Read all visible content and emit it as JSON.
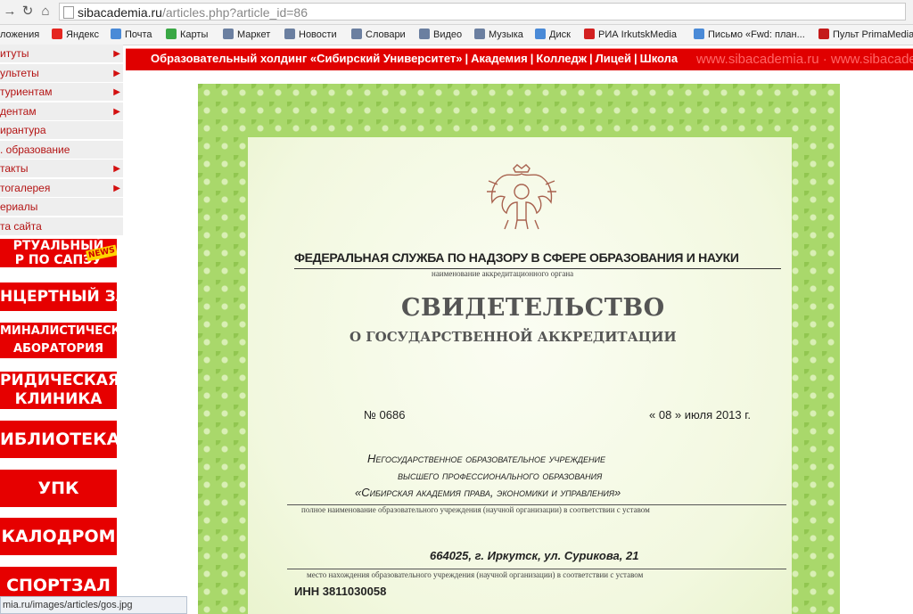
{
  "browser": {
    "url_host": "sibacademia.ru",
    "url_path": "/articles.php?article_id=86"
  },
  "bookmarks": [
    {
      "label": "ложения",
      "color": "#3b79d6"
    },
    {
      "label": "Яндекс",
      "color": "#e52620"
    },
    {
      "label": "Почта",
      "color": "#4a8ad7"
    },
    {
      "label": "Карты",
      "color": "#3aa845"
    },
    {
      "label": "Маркет",
      "color": "#6b7fa0"
    },
    {
      "label": "Новости",
      "color": "#6b7fa0"
    },
    {
      "label": "Словари",
      "color": "#6b7fa0"
    },
    {
      "label": "Видео",
      "color": "#6b7fa0"
    },
    {
      "label": "Музыка",
      "color": "#6b7fa0"
    },
    {
      "label": "Диск",
      "color": "#4a8ad7"
    },
    {
      "label": "РИА IrkutskMedia",
      "color": "#d32020"
    },
    {
      "label": "Письмо «Fwd: план...",
      "color": "#4a8ad7"
    },
    {
      "label": "Пульт PrimaMedia",
      "color": "#c41a1a"
    }
  ],
  "sidebar": {
    "menu": [
      {
        "label": "итуты",
        "arrow": "▶"
      },
      {
        "label": "ультеты",
        "arrow": "▶"
      },
      {
        "label": "туриентам",
        "arrow": "▶"
      },
      {
        "label": "дентам",
        "arrow": "▶"
      },
      {
        "label": "ирантура",
        "arrow": ""
      },
      {
        "label": ". образование",
        "arrow": ""
      },
      {
        "label": "такты",
        "arrow": "▶"
      },
      {
        "label": "тогалерея",
        "arrow": "▶"
      },
      {
        "label": "ериалы",
        "arrow": ""
      },
      {
        "label": "та сайта",
        "arrow": ""
      }
    ],
    "banners": [
      {
        "line1": "РТУАЛЬНЫЙ",
        "line2": "Р ПО САПЭУ",
        "badge": "NEWS"
      },
      {
        "line1": "НЦЕРТНЫЙ ЗАЛ",
        "line2": ""
      },
      {
        "line1": "МИНАЛИСТИЧЕСКАЯ",
        "line2": "АБОРАТОРИЯ"
      },
      {
        "line1": "РИДИЧЕСКАЯ",
        "line2": "КЛИНИКА"
      },
      {
        "line1": "ИБЛИОТЕКА",
        "line2": ""
      },
      {
        "line1": "УПК",
        "line2": ""
      },
      {
        "line1": "КАЛОДРОМ",
        "line2": ""
      },
      {
        "line1": "СПОРТЗАЛ",
        "line2": ""
      }
    ]
  },
  "topnav": {
    "links": [
      "Образовательный холдинг «Сибирский Университет»",
      "Академия",
      "Колледж",
      "Лицей",
      "Школа"
    ],
    "watermark": "www.sibacademia.ru · www.sibacade"
  },
  "certificate": {
    "agency": "ФЕДЕРАЛЬНАЯ СЛУЖБА ПО НАДЗОРУ В СФЕРЕ ОБРАЗОВАНИЯ И НАУКИ",
    "agency_caption": "наименование аккредитационного органа",
    "title": "СВИДЕТЕЛЬСТВО",
    "subtitle": "О ГОСУДАРСТВЕННОЙ АККРЕДИТАЦИИ",
    "number": "№ 0686",
    "date": "« 08 » июля  2013 г.",
    "org_line1": "Негосударственное образовательное учреждение",
    "org_line2": "высшего профессионального образования",
    "org_line3": "«Сибирская академия права, экономики и управления»",
    "org_caption": "полное наименование образовательного учреждения (научной организации) в соответствии с уставом",
    "address": "664025, г. Иркутск, ул. Сурикова, 21",
    "address_caption": "место нахождения образовательного учреждения (научной организации) в соответствии с уставом",
    "inn": "ИНН 3811030058"
  },
  "status_bar": {
    "text": "mia.ru/images/articles/gos.jpg"
  }
}
